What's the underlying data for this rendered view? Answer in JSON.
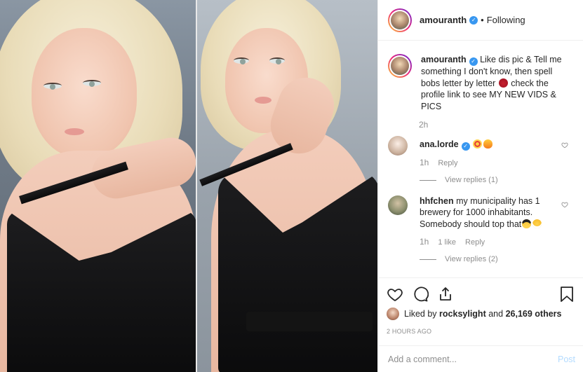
{
  "header": {
    "username": "amouranth",
    "separator": "•",
    "follow_status": "Following"
  },
  "caption": {
    "username": "amouranth",
    "text_part1": "Like dis pic & Tell me something I don't know, then spell bobs letter by letter",
    "text_part2": "check the profile link to see MY NEW VIDS & PICS",
    "time": "2h"
  },
  "comments": [
    {
      "username": "ana.lorde",
      "verified": true,
      "text": "",
      "emojis": [
        "heart-eyes",
        "fire"
      ],
      "time": "1h",
      "likes": "",
      "reply_label": "Reply",
      "view_replies": "View replies (1)"
    },
    {
      "username": "hhfchen",
      "verified": false,
      "text": "my municipality has 1 brewery for 1000 inhabitants. Somebody should top that",
      "emojis": [
        "cool",
        "grin"
      ],
      "time": "1h",
      "likes": "1 like",
      "reply_label": "Reply",
      "view_replies": "View replies (2)"
    }
  ],
  "likes": {
    "prefix": "Liked by",
    "user": "rocksylight",
    "middle": "and",
    "count": "26,169 others"
  },
  "posted": "2 HOURS AGO",
  "add_comment": {
    "placeholder": "Add a comment...",
    "post_label": "Post"
  },
  "icons": [
    "heart-icon",
    "comment-icon",
    "share-icon",
    "bookmark-icon"
  ],
  "colors": {
    "verified": "#3897f0",
    "muted": "#8e8e8e",
    "post_disabled": "#b3dbff"
  }
}
